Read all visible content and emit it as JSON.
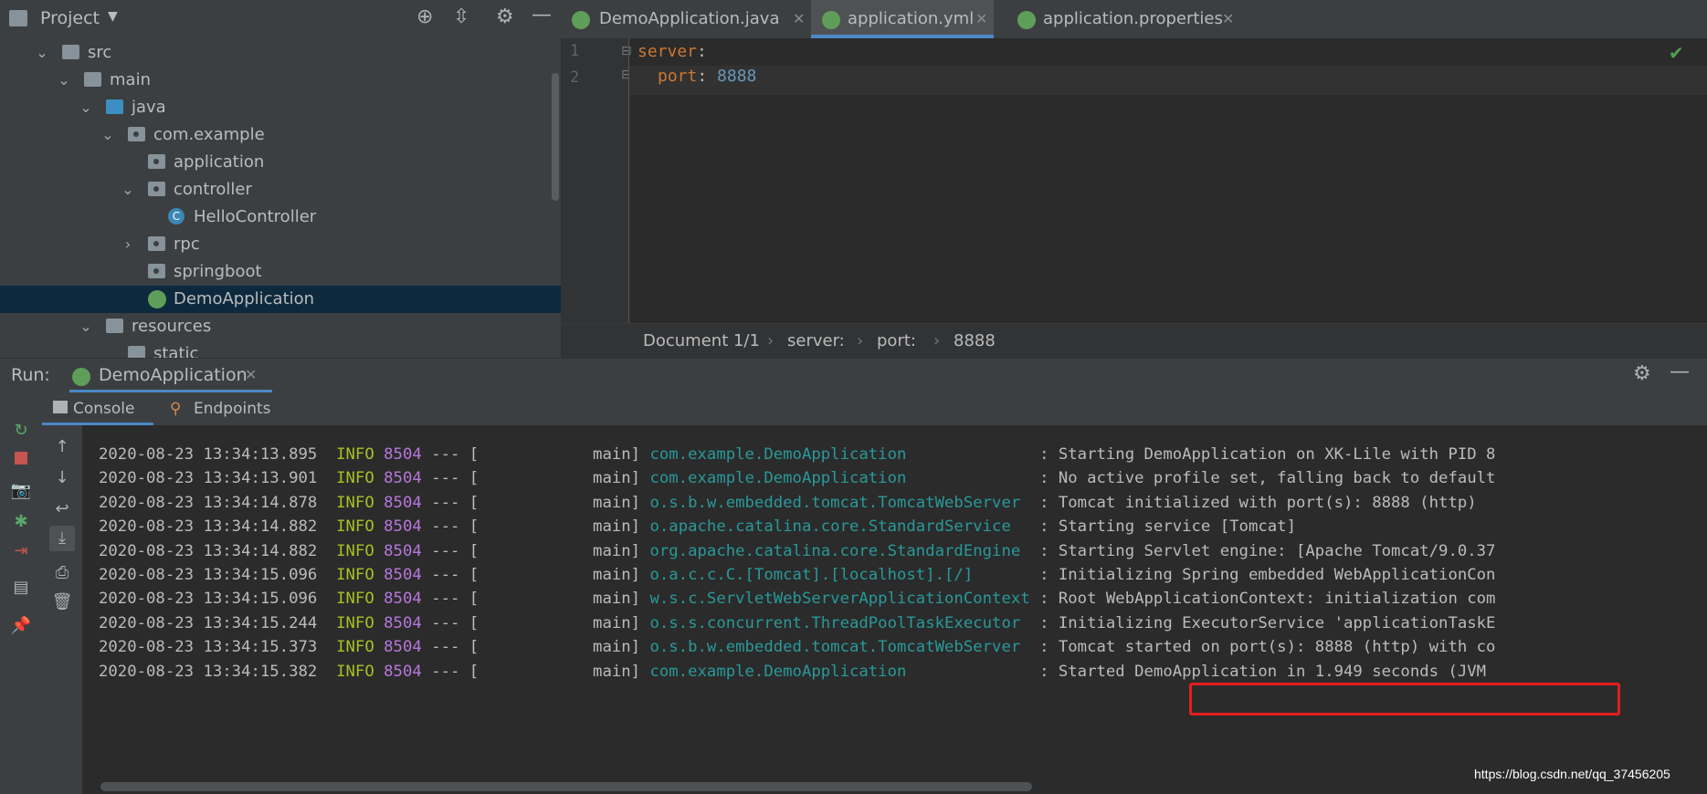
{
  "project": {
    "title": "Project",
    "tree": [
      {
        "label": "src",
        "type": "folder",
        "expanded": true
      },
      {
        "label": "main",
        "type": "folder",
        "expanded": true
      },
      {
        "label": "java",
        "type": "folder-blue",
        "expanded": true
      },
      {
        "label": "com.example",
        "type": "package",
        "expanded": true
      },
      {
        "label": "application",
        "type": "package"
      },
      {
        "label": "controller",
        "type": "package",
        "expanded": true
      },
      {
        "label": "HelloController",
        "type": "class"
      },
      {
        "label": "rpc",
        "type": "package",
        "expanded": false
      },
      {
        "label": "springboot",
        "type": "package"
      },
      {
        "label": "DemoApplication",
        "type": "spring-class",
        "selected": true
      },
      {
        "label": "resources",
        "type": "resources",
        "expanded": true
      },
      {
        "label": "static",
        "type": "folder"
      }
    ]
  },
  "editor": {
    "tabs": [
      {
        "label": "DemoApplication.java",
        "active": false
      },
      {
        "label": "application.yml",
        "active": true
      },
      {
        "label": "application.properties",
        "active": false
      }
    ],
    "lines": [
      {
        "num": "1",
        "key": "server",
        "sep": ":",
        "value": ""
      },
      {
        "num": "2",
        "key": "port",
        "sep": ": ",
        "value": "8888"
      }
    ],
    "breadcrumbs": [
      "Document 1/1",
      "server:",
      "port:",
      "8888"
    ]
  },
  "run": {
    "label": "Run:",
    "config": "DemoApplication",
    "subtabs": [
      "Console",
      "Endpoints"
    ],
    "log": [
      {
        "ts": "2020-08-23 13:34:13.895",
        "level": "INFO",
        "pid": "8504",
        "sep": "--- [",
        "thread": "main]",
        "logger": "com.example.DemoApplication",
        "msg": ": Starting DemoApplication on XK-Lile with PID 8"
      },
      {
        "ts": "2020-08-23 13:34:13.901",
        "level": "INFO",
        "pid": "8504",
        "sep": "--- [",
        "thread": "main]",
        "logger": "com.example.DemoApplication",
        "msg": ": No active profile set, falling back to default"
      },
      {
        "ts": "2020-08-23 13:34:14.878",
        "level": "INFO",
        "pid": "8504",
        "sep": "--- [",
        "thread": "main]",
        "logger": "o.s.b.w.embedded.tomcat.TomcatWebServer",
        "msg": ": Tomcat initialized with port(s): 8888 (http)"
      },
      {
        "ts": "2020-08-23 13:34:14.882",
        "level": "INFO",
        "pid": "8504",
        "sep": "--- [",
        "thread": "main]",
        "logger": "o.apache.catalina.core.StandardService",
        "msg": ": Starting service [Tomcat]"
      },
      {
        "ts": "2020-08-23 13:34:14.882",
        "level": "INFO",
        "pid": "8504",
        "sep": "--- [",
        "thread": "main]",
        "logger": "org.apache.catalina.core.StandardEngine",
        "msg": ": Starting Servlet engine: [Apache Tomcat/9.0.37"
      },
      {
        "ts": "2020-08-23 13:34:15.096",
        "level": "INFO",
        "pid": "8504",
        "sep": "--- [",
        "thread": "main]",
        "logger": "o.a.c.c.C.[Tomcat].[localhost].[/]",
        "msg": ": Initializing Spring embedded WebApplicationCon"
      },
      {
        "ts": "2020-08-23 13:34:15.096",
        "level": "INFO",
        "pid": "8504",
        "sep": "--- [",
        "thread": "main]",
        "logger": "w.s.c.ServletWebServerApplicationContext",
        "msg": ": Root WebApplicationContext: initialization com"
      },
      {
        "ts": "2020-08-23 13:34:15.244",
        "level": "INFO",
        "pid": "8504",
        "sep": "--- [",
        "thread": "main]",
        "logger": "o.s.s.concurrent.ThreadPoolTaskExecutor",
        "msg": ": Initializing ExecutorService 'applicationTaskE"
      },
      {
        "ts": "2020-08-23 13:34:15.373",
        "level": "INFO",
        "pid": "8504",
        "sep": "--- [",
        "thread": "main]",
        "logger": "o.s.b.w.embedded.tomcat.TomcatWebServer",
        "msg": ": Tomcat started on port(s): 8888 (http) with co"
      },
      {
        "ts": "2020-08-23 13:34:15.382",
        "level": "INFO",
        "pid": "8504",
        "sep": "--- [",
        "thread": "main]",
        "logger": "com.example.DemoApplication",
        "msg": ": Started DemoApplication in 1.949 seconds (JVM"
      }
    ]
  },
  "watermark": "https://blog.csdn.net/qq_37456205",
  "colors": {
    "selection": "#0d293e",
    "tab_underline": "#4a88c7",
    "keyword": "#cc7832",
    "number": "#6897bb",
    "log_level": "#a8c023",
    "log_pid": "#b877db",
    "logger": "#299999",
    "highlight_box": "#e31e1e",
    "stop": "#c75450",
    "rerun": "#59a869"
  },
  "icons": [
    "crosshair-icon",
    "collapse-icon",
    "gear-icon",
    "minimize-icon",
    "rerun-icon",
    "stop-icon",
    "camera-icon",
    "bug-icon",
    "exit-icon",
    "layout-icon",
    "pin-icon",
    "up-arrow-icon",
    "down-arrow-icon",
    "soft-wrap-icon",
    "scroll-to-end-icon",
    "print-icon",
    "trash-icon",
    "checkmark-icon",
    "console-icon",
    "endpoints-icon"
  ]
}
